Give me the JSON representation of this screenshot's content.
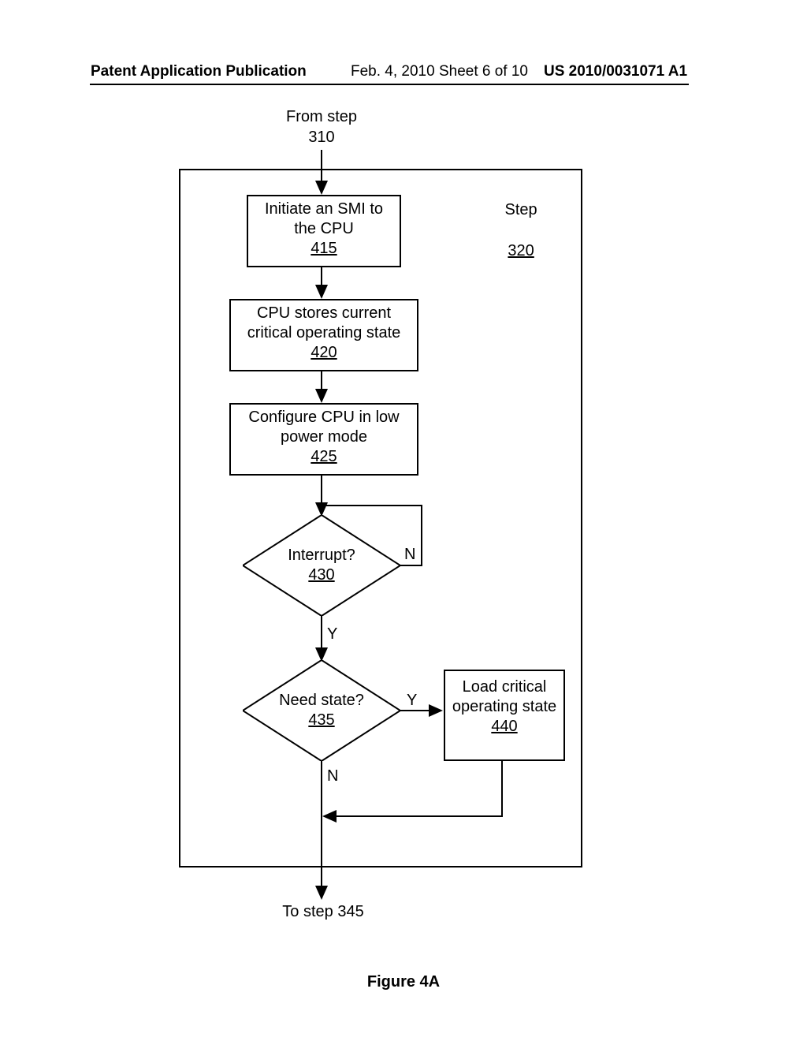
{
  "header": {
    "left": "Patent Application Publication",
    "mid": "Feb. 4, 2010  Sheet 6 of 10",
    "right": "US 2010/0031071 A1"
  },
  "labels": {
    "from_step": "From step\n310",
    "to_step": "To step 345",
    "step_label_text": "Step",
    "step_label_ref": "320",
    "figure": "Figure 4A"
  },
  "boxes": {
    "b415": {
      "text": "Initiate an SMI to\nthe CPU",
      "ref": "415"
    },
    "b420": {
      "text": "CPU stores current\ncritical operating state",
      "ref": "420"
    },
    "b425": {
      "text": "Configure CPU in low\npower mode",
      "ref": "425"
    },
    "b440": {
      "text": "Load critical\noperating state",
      "ref": "440"
    }
  },
  "diamonds": {
    "d430": {
      "text": "Interrupt?",
      "ref": "430"
    },
    "d435": {
      "text": "Need state?",
      "ref": "435"
    }
  },
  "branches": {
    "y": "Y",
    "n": "N"
  }
}
